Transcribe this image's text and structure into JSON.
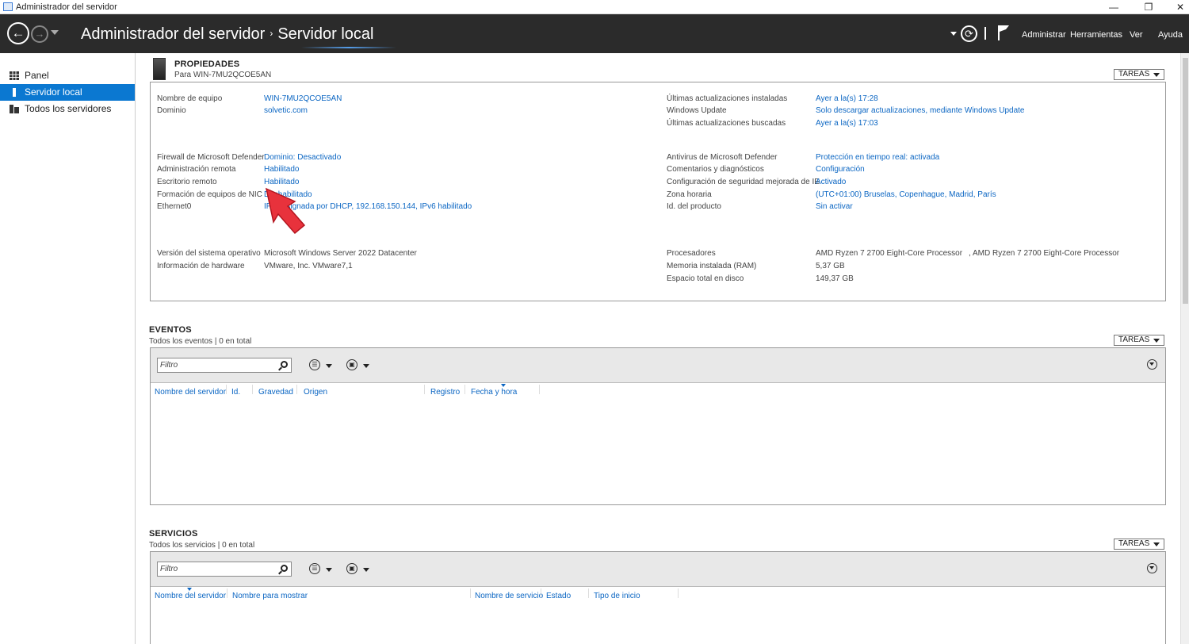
{
  "window": {
    "title": "Administrador del servidor"
  },
  "header": {
    "app_name": "Administrador del servidor",
    "crumb_sep": "›",
    "page": "Servidor local",
    "menus": [
      "Administrar",
      "Herramientas",
      "Ver",
      "Ayuda"
    ]
  },
  "sidebar": {
    "items": [
      {
        "label": "Panel",
        "icon": "grid-icon"
      },
      {
        "label": "Servidor local",
        "icon": "server-icon",
        "active": true
      },
      {
        "label": "Todos los servidores",
        "icon": "servers-icon"
      }
    ]
  },
  "properties": {
    "heading": "PROPIEDADES",
    "subtitle": "Para WIN-7MU2QCOE5AN",
    "tasks_label": "TAREAS",
    "left": [
      {
        "label": "Nombre de equipo",
        "value": "WIN-7MU2QCOE5AN",
        "link": true
      },
      {
        "label": "Dominio",
        "value": "solvetic.com",
        "link": true
      },
      {
        "label": "Firewall de Microsoft Defender",
        "value": "Dominio: Desactivado",
        "link": true
      },
      {
        "label": "Administración remota",
        "value": "Habilitado",
        "link": true
      },
      {
        "label": "Escritorio remoto",
        "value": "Habilitado",
        "link": true
      },
      {
        "label": "Formación de equipos de NIC",
        "value": "Deshabilitado",
        "link": true
      },
      {
        "label": "Ethernet0",
        "value": "IPv4 asignada por DHCP, 192.168.150.144, IPv6 habilitado",
        "link": true
      },
      {
        "label": "Versión del sistema operativo",
        "value": "Microsoft Windows Server 2022 Datacenter",
        "link": false
      },
      {
        "label": "Información de hardware",
        "value": "VMware, Inc. VMware7,1",
        "link": false
      }
    ],
    "right": [
      {
        "label": "Últimas actualizaciones instaladas",
        "value": "Ayer a la(s) 17:28",
        "link": true
      },
      {
        "label": "Windows Update",
        "value": "Solo descargar actualizaciones, mediante Windows Update",
        "link": true
      },
      {
        "label": "Últimas actualizaciones buscadas",
        "value": "Ayer a la(s) 17:03",
        "link": true
      },
      {
        "label": "Antivirus de Microsoft Defender",
        "value": "Protección en tiempo real: activada",
        "link": true
      },
      {
        "label": "Comentarios y diagnósticos",
        "value": "Configuración",
        "link": true
      },
      {
        "label": "Configuración de seguridad mejorada de IE",
        "value": "Activado",
        "link": true
      },
      {
        "label": "Zona horaria",
        "value": "(UTC+01:00) Bruselas, Copenhague, Madrid, París",
        "link": true
      },
      {
        "label": "Id. del producto",
        "value": "Sin activar",
        "link": true
      },
      {
        "label": "Procesadores",
        "value": "AMD Ryzen 7 2700 Eight-Core Processor",
        "value2": ", AMD Ryzen 7 2700 Eight-Core Processor",
        "link": false
      },
      {
        "label": "Memoria instalada (RAM)",
        "value": "5,37 GB",
        "link": false
      },
      {
        "label": "Espacio total en disco",
        "value": "149,37 GB",
        "link": false
      }
    ]
  },
  "events": {
    "heading": "EVENTOS",
    "subtitle": "Todos los eventos | 0 en total",
    "tasks_label": "TAREAS",
    "filter_placeholder": "Filtro",
    "columns": [
      "Nombre del servidor",
      "Id.",
      "Gravedad",
      "Origen",
      "Registro",
      "Fecha y hora"
    ]
  },
  "services": {
    "heading": "SERVICIOS",
    "subtitle": "Todos los servicios | 0 en total",
    "tasks_label": "TAREAS",
    "filter_placeholder": "Filtro",
    "columns": [
      "Nombre del servidor",
      "Nombre para mostrar",
      "Nombre de servicio",
      "Estado",
      "Tipo de inicio"
    ]
  },
  "colors": {
    "accent": "#0b78d1",
    "link": "#0b66c3",
    "header_bg": "#2b2b2b",
    "annotation_arrow": "#e8323c"
  }
}
